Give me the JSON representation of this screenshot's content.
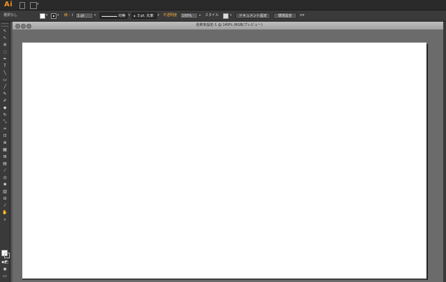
{
  "app": {
    "logo": "Ai"
  },
  "appbar": {
    "icons": [
      "bridge-icon",
      "arrange-documents-icon"
    ]
  },
  "control": {
    "selection_text": "選択なし",
    "stroke_label": "線 :",
    "stroke_weight": "1 pt",
    "stroke_profile": "均等",
    "brush": "3 pt. 丸筆",
    "opacity_label": "不透明度",
    "opacity_value": "100%",
    "style_label": "スタイル",
    "doc_setup_button": "ドキュメント設定",
    "prefs_button": "環境設定"
  },
  "document": {
    "title": "名称未設定-1 @ 149% (RGB/プレビュー)"
  },
  "tools": [
    "selection-tool",
    "direct-selection-tool",
    "magic-wand-tool",
    "lasso-tool",
    "pen-tool",
    "type-tool",
    "line-segment-tool",
    "rectangle-tool",
    "paintbrush-tool",
    "pencil-tool",
    "blob-brush-tool",
    "eraser-tool",
    "rotate-tool",
    "scale-tool",
    "width-tool",
    "free-transform-tool",
    "shape-builder-tool",
    "perspective-grid-tool",
    "mesh-tool",
    "gradient-tool",
    "eyedropper-tool",
    "blend-tool",
    "symbol-sprayer-tool",
    "column-graph-tool",
    "artboard-tool",
    "slice-tool",
    "hand-tool",
    "zoom-tool"
  ],
  "colors": {
    "app_bg": "#535353",
    "panel": "#3a3a3a",
    "logo": "#f7931e",
    "opacity_label": "#f4a93b",
    "artboard": "#ffffff"
  }
}
